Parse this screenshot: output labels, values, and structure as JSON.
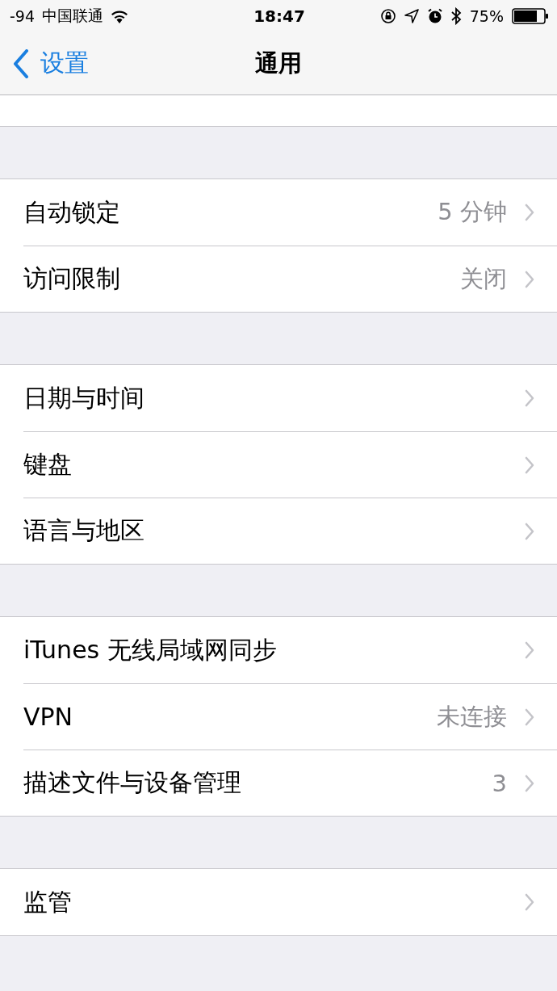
{
  "status_bar": {
    "signal": "-94",
    "carrier": "中国联通",
    "time": "18:47",
    "battery": "75%"
  },
  "nav_bar": {
    "back": "设置",
    "title": "通用"
  },
  "groups": [
    [
      {
        "label": "自动锁定",
        "value": "5 分钟"
      },
      {
        "label": "访问限制",
        "value": "关闭"
      }
    ],
    [
      {
        "label": "日期与时间"
      },
      {
        "label": "键盘"
      },
      {
        "label": "语言与地区"
      }
    ],
    [
      {
        "label": "iTunes 无线局域网同步"
      },
      {
        "label": "VPN",
        "value": "未连接"
      },
      {
        "label": "描述文件与设备管理",
        "value": "3"
      }
    ],
    [
      {
        "label": "监管"
      }
    ]
  ]
}
